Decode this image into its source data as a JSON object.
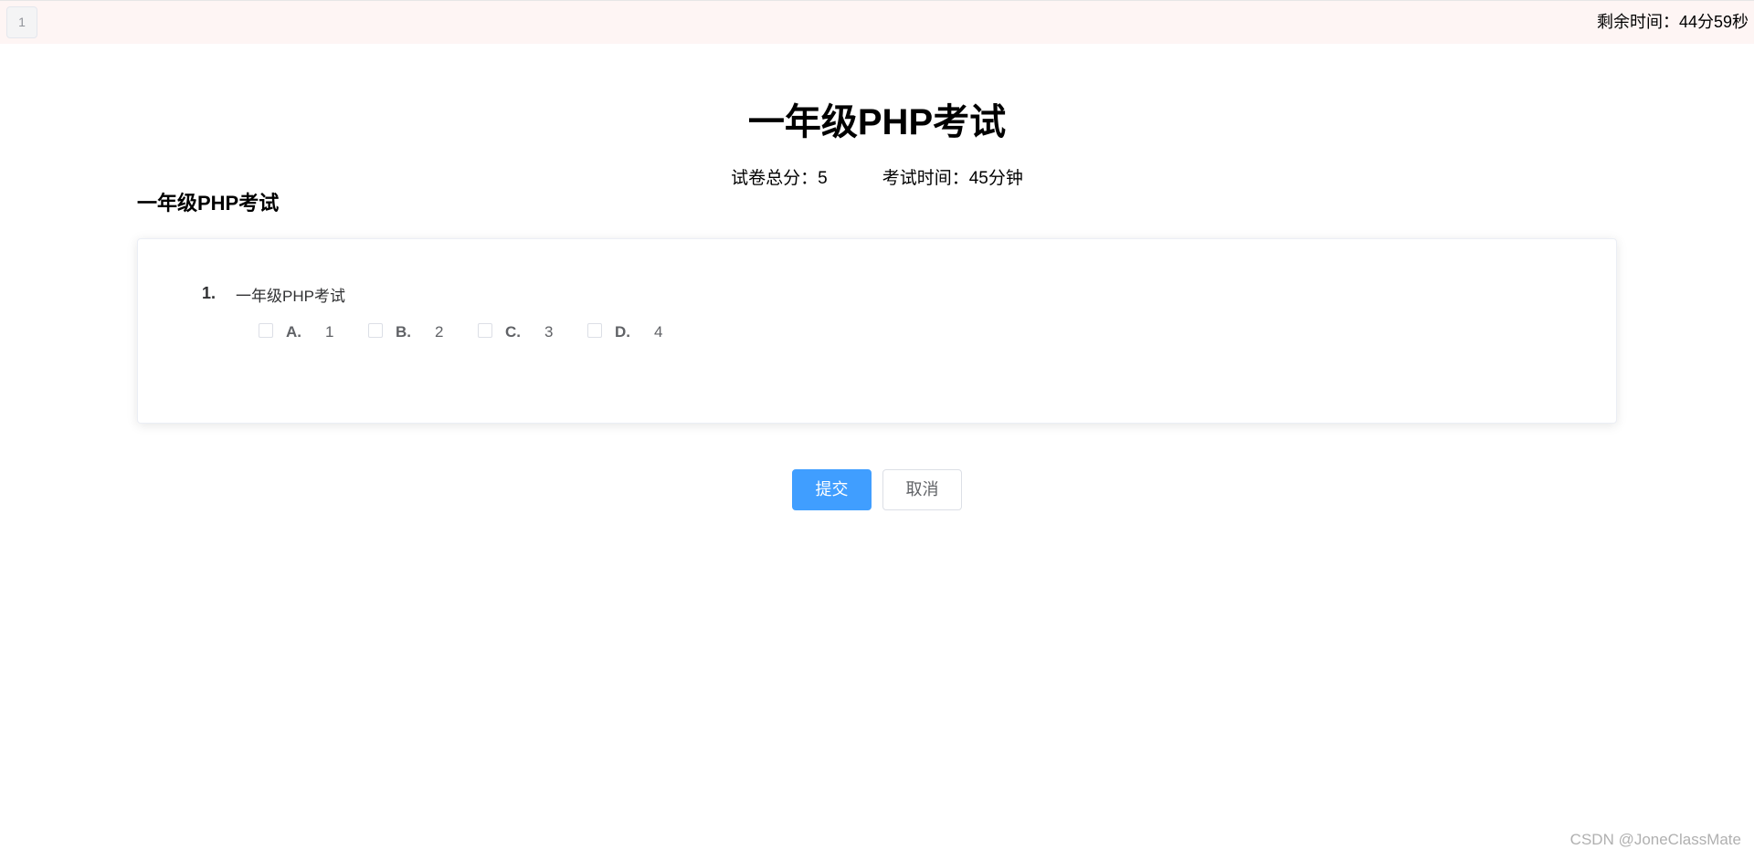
{
  "header": {
    "question_nav": [
      "1"
    ],
    "timer_label": "剩余时间：",
    "timer_value": "44分59秒"
  },
  "exam": {
    "title": "一年级PHP考试",
    "total_score_label": "试卷总分：",
    "total_score": "5",
    "duration_label": "考试时间：",
    "duration": "45分钟"
  },
  "section": {
    "title": "一年级PHP考试"
  },
  "questions": [
    {
      "number": "1.",
      "text": "一年级PHP考试",
      "options": [
        {
          "letter": "A.",
          "value": "1",
          "checked": false
        },
        {
          "letter": "B.",
          "value": "2",
          "checked": false
        },
        {
          "letter": "C.",
          "value": "3",
          "checked": false
        },
        {
          "letter": "D.",
          "value": "4",
          "checked": false
        }
      ]
    }
  ],
  "actions": {
    "submit_label": "提交",
    "cancel_label": "取消"
  },
  "watermark": "CSDN @JoneClassMate"
}
